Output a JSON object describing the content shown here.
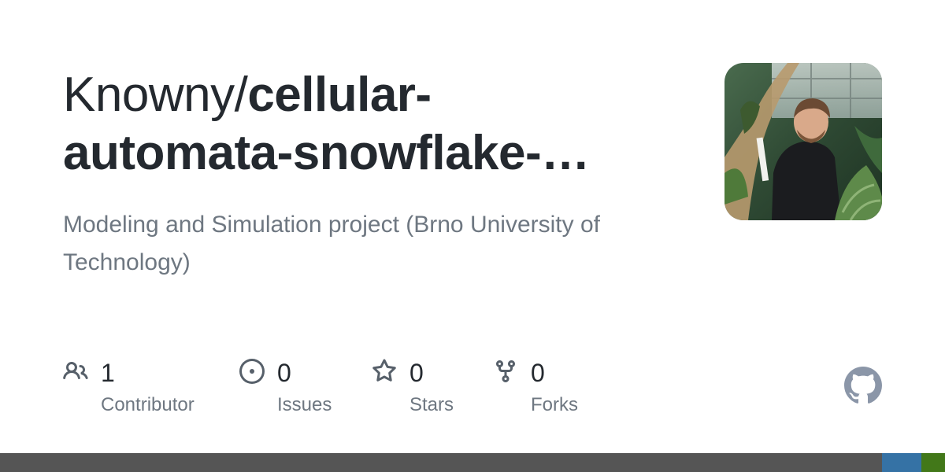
{
  "repo": {
    "owner": "Knowny/",
    "name_line1": "cellular-",
    "name_line2": "automata-snowflake-…",
    "description": "Modeling and Simulation project (Brno University of Technology)"
  },
  "stats": {
    "contributors": {
      "value": "1",
      "label": "Contributor",
      "icon": "people-icon"
    },
    "issues": {
      "value": "0",
      "label": "Issues",
      "icon": "issue-opened-icon"
    },
    "stars": {
      "value": "0",
      "label": "Stars",
      "icon": "star-icon"
    },
    "forks": {
      "value": "0",
      "label": "Forks",
      "icon": "repo-forked-icon"
    }
  },
  "language_bar": {
    "segments": [
      {
        "color": "#555555",
        "fraction": 0.933
      },
      {
        "color": "#3572A5",
        "fraction": 0.042
      },
      {
        "color": "#427819",
        "fraction": 0.025
      }
    ]
  },
  "colors": {
    "title": "#24292f",
    "muted": "#6e7781",
    "icon": "#57606a",
    "github_mark": "#8b96a8"
  }
}
